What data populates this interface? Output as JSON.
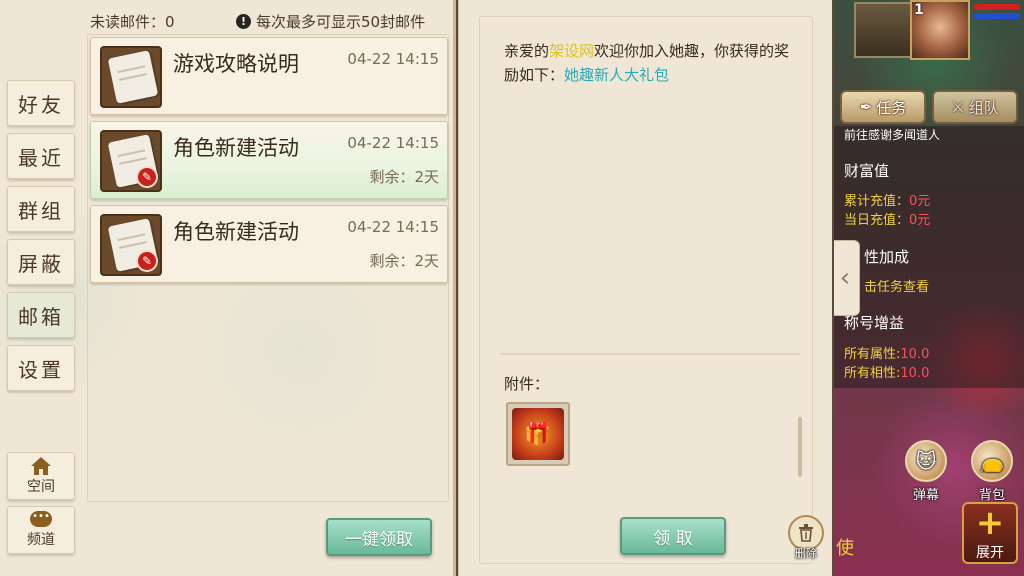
{
  "mailbox": {
    "unread_label": "未读邮件：0",
    "notice": "每次最多可显示50封邮件",
    "claim_all_label": "一键领取"
  },
  "side_tabs": [
    {
      "label": "好友"
    },
    {
      "label": "最近"
    },
    {
      "label": "群组"
    },
    {
      "label": "屏蔽"
    },
    {
      "label": "邮箱"
    },
    {
      "label": "设置"
    }
  ],
  "side_utils": {
    "space_label": "空间",
    "chat_label": "频道"
  },
  "mails": [
    {
      "title": "游戏攻略说明",
      "time": "04-22 14:15",
      "remaining": ""
    },
    {
      "title": "角色新建活动",
      "time": "04-22 14:15",
      "remaining": "剩余：2天"
    },
    {
      "title": "角色新建活动",
      "time": "04-22 14:15",
      "remaining": "剩余：2天"
    }
  ],
  "detail": {
    "greeting_prefix": "亲爱的",
    "player_name": "架设网",
    "greeting_body": "欢迎你加入她趣，你获得的奖励如下：",
    "reward_name": "她趣新人大礼包",
    "attachment_label": "附件：",
    "claim_label": "领 取",
    "delete_label": "删除"
  },
  "hud": {
    "level": "1",
    "task_label": "任务",
    "team_label": "组队",
    "quest_hint": "前往感谢多闻道人",
    "wealth_title": "财富值",
    "total_recharge_label": "累计充值：",
    "total_recharge_value": "0元",
    "daily_recharge_label": "当日充值：",
    "daily_recharge_value": "0元",
    "attr_bonus_title": "性加成",
    "attr_hint": "击任务查看",
    "title_bonus_title": "称号增益",
    "all_attr_label": "所有属性:",
    "all_attr_value": "10.0",
    "all_phase_label": "所有相性:",
    "all_phase_value": "10.0",
    "banner_label": "弹幕",
    "bag_label": "背包",
    "expand_label": "展开",
    "edge_char": "使"
  },
  "colors": {
    "accent_green": "#6ab89a",
    "highlight_yellow": "#e0c020",
    "highlight_cyan": "#2aa9b8",
    "value_red": "#ff5060"
  }
}
